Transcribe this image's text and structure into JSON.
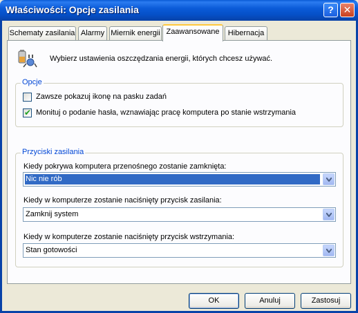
{
  "window": {
    "title": "Właściwości: Opcje zasilania",
    "help_glyph": "?",
    "close_glyph": "✕"
  },
  "tabs": [
    {
      "label": "Schematy zasilania"
    },
    {
      "label": "Alarmy"
    },
    {
      "label": "Miernik energii"
    },
    {
      "label": "Zaawansowane"
    },
    {
      "label": "Hibernacja"
    }
  ],
  "active_tab": "Zaawansowane",
  "intro": {
    "text": "Wybierz ustawienia oszczędzania energii, których chcesz używać."
  },
  "options_group": {
    "label": "Opcje",
    "checkboxes": [
      {
        "label": "Zawsze pokazuj ikonę na pasku zadań",
        "checked": false
      },
      {
        "label": "Monituj o podanie hasła, wznawiając pracę komputera po stanie wstrzymania",
        "checked": true
      }
    ]
  },
  "power_buttons_group": {
    "label": "Przyciski zasilania",
    "fields": [
      {
        "label": "Kiedy pokrywa komputera przenośnego zostanie zamknięta:",
        "value": "Nic nie rób"
      },
      {
        "label": "Kiedy w komputerze zostanie naciśnięty przycisk zasilania:",
        "value": "Zamknij system"
      },
      {
        "label": "Kiedy w komputerze zostanie naciśnięty przycisk wstrzymania:",
        "value": "Stan gotowości"
      }
    ]
  },
  "buttons": {
    "ok": "OK",
    "cancel": "Anuluj",
    "apply": "Zastosuj"
  },
  "check_glyph": "✔",
  "colors": {
    "title_bar": "#0b5bd8",
    "group_label": "#0046d5",
    "selection": "#316ac5",
    "dialog_bg": "#ece9d8"
  },
  "icons": {
    "power_options": "power-plug-battery-icon",
    "dropdown": "chevron-down-icon"
  }
}
